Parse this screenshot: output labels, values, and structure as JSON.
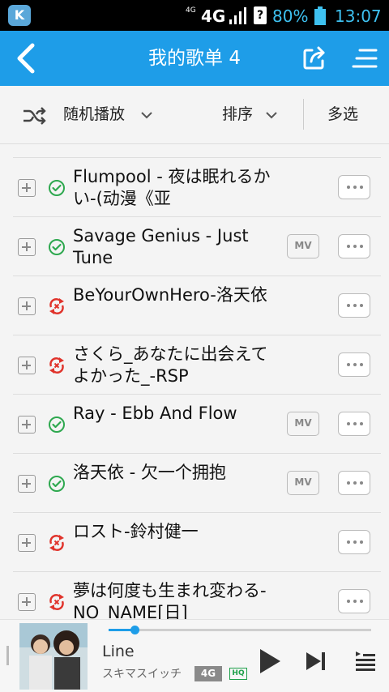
{
  "status_bar": {
    "app_badge": "K",
    "net_small": "4G",
    "network": "4G",
    "sim_q": "?",
    "battery_pct": "80%",
    "time": "13:07",
    "accent_color": "#3ec1f0"
  },
  "header": {
    "title": "我的歌单 4",
    "bg_color": "#1e9de8",
    "back_icon": "back-chevron-icon",
    "share_icon": "share-icon",
    "menu_icon": "menu-icon"
  },
  "toolbar": {
    "shuffle_label": "随机播放",
    "sort_label": "排序",
    "multi_select_label": "多选"
  },
  "songs": [
    {
      "title": "Flumpool - 夜は眠れるかい-(动漫《亚",
      "status": "ok",
      "mv": false
    },
    {
      "title": "Savage Genius - Just Tune",
      "status": "ok",
      "mv": true
    },
    {
      "title": "BeYourOwnHero-洛天依",
      "status": "error",
      "mv": false
    },
    {
      "title": "さくら_あなたに出会えてよかった_-RSP",
      "status": "error",
      "mv": false
    },
    {
      "title": "Ray - Ebb And Flow",
      "status": "ok",
      "mv": true
    },
    {
      "title": "洛天依 - 欠一个拥抱",
      "status": "ok",
      "mv": true
    },
    {
      "title": "ロスト-鈴村健一",
      "status": "error",
      "mv": false
    },
    {
      "title": "夢は何度も生まれ変わる-NO_NAME[日]",
      "status": "error",
      "mv": false
    }
  ],
  "mv_label": "MV",
  "status_colors": {
    "ok": "#2ea84f",
    "error": "#e0332b"
  },
  "now_playing": {
    "title": "Line",
    "artist": "スキマスイッチ",
    "net_badge": "4G",
    "quality_badge": "HQ",
    "progress": 0.1
  }
}
